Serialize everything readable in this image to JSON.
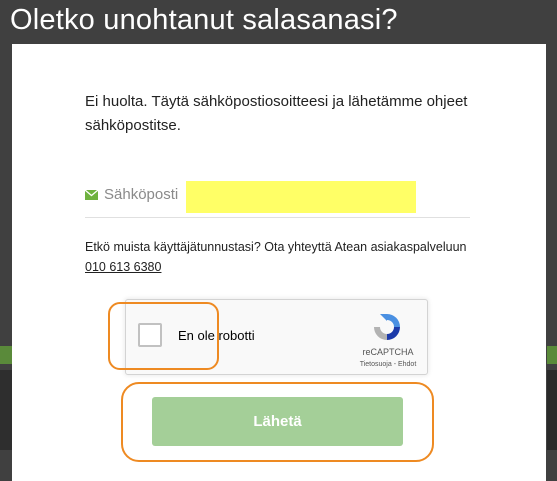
{
  "dialog": {
    "title": "Oletko unohtanut salasanasi?",
    "intro": "Ei huolta. Täytä sähköpostiosoitteesi ja lähetämme ohjeet sähköpostitse.",
    "email": {
      "label": "Sähköposti",
      "icon": "envelope-icon",
      "value": ""
    },
    "contact": {
      "text": "Etkö muista käyttäjätunnustasi? Ota yhteyttä Atean asiakaspalveluun ",
      "phone": "010 613 6380"
    },
    "captcha": {
      "label": "En ole robotti",
      "brand": "reCAPTCHA",
      "links": "Tietosuoja - Ehdot"
    },
    "submit_label": "Lähetä"
  },
  "colors": {
    "accent_green": "#6fb23f",
    "button_disabled": "#a4cf98",
    "highlight": "#ee8a22",
    "field_highlight": "#ffff66"
  }
}
